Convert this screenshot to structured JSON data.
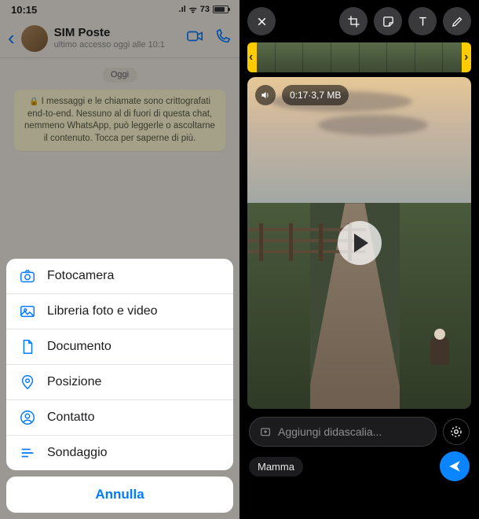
{
  "status": {
    "time": "10:15",
    "battery": "73"
  },
  "chat": {
    "title": "SIM Poste",
    "subtitle": "ultimo accesso oggi alle 10:1",
    "date_chip": "Oggi",
    "encryption": "I messaggi e le chiamate sono crittografati end-to-end. Nessuno al di fuori di questa chat, nemmeno WhatsApp, può leggerle o ascoltarne il contenuto. Tocca per saperne di più."
  },
  "sheet": {
    "items": [
      {
        "icon": "camera-icon",
        "label": "Fotocamera"
      },
      {
        "icon": "gallery-icon",
        "label": "Libreria foto e video"
      },
      {
        "icon": "document-icon",
        "label": "Documento"
      },
      {
        "icon": "location-icon",
        "label": "Posizione"
      },
      {
        "icon": "contact-icon",
        "label": "Contatto"
      },
      {
        "icon": "poll-icon",
        "label": "Sondaggio"
      }
    ],
    "cancel": "Annulla"
  },
  "editor": {
    "duration": "0:17",
    "size": "3,7 MB",
    "meta_sep": " · ",
    "caption_placeholder": "Aggiungi didascalia...",
    "recipient": "Mamma"
  },
  "colors": {
    "ios_blue": "#007aff",
    "send_blue": "#0a84ff",
    "trim_yellow": "#ffcc00",
    "sheet_text": "#1c1c1e",
    "encryption_bg": "#fef7d1"
  }
}
